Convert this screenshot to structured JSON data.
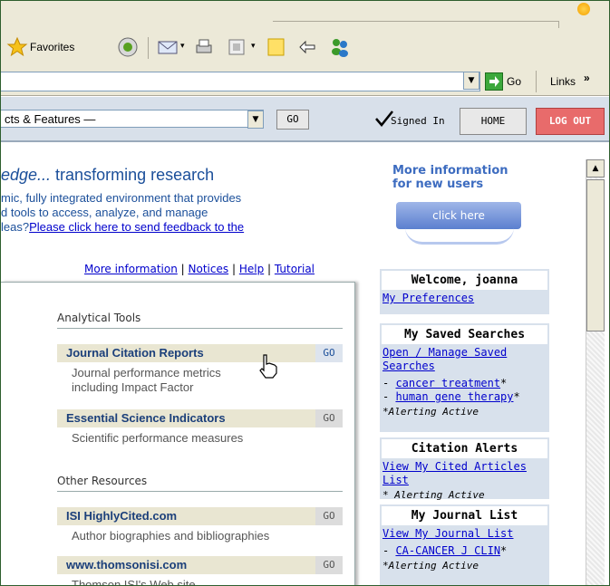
{
  "browser": {
    "toolbar": {
      "favorites_label": "Favorites",
      "icons": [
        "favorites-star-icon",
        "media-icon",
        "mail-icon",
        "print-icon",
        "edit-icon",
        "discuss-icon",
        "research-icon",
        "messenger-icon"
      ]
    },
    "address": {
      "go_label": "Go",
      "links_label": "Links",
      "links_chevron": "»"
    }
  },
  "app_header": {
    "product_select_value": "cts & Features —",
    "go_label": "GO",
    "signed_in_label": "Signed In",
    "home_label": "HOME",
    "logout_label": "LOG OUT"
  },
  "main": {
    "tagline_prefix": "edge...",
    "tagline_rest": " transforming research",
    "intro_lines": [
      "mic, fully integrated environment that provides",
      "d tools to access, analyze, and manage",
      "leas?"
    ],
    "feedback_link": "Please click here to send feedback to the",
    "links": {
      "more_info": "More information",
      "notices": "Notices",
      "help": "Help",
      "tutorial": "Tutorial",
      "sep": "|"
    },
    "analytical_tools_heading": "Analytical Tools",
    "other_resources_heading": "Other Resources",
    "products": [
      {
        "name": "Journal Citation Reports",
        "go": "GO",
        "desc": "Journal performance metrics including Impact Factor"
      },
      {
        "name": "Essential Science Indicators",
        "go": "GO",
        "desc": "Scientific performance measures"
      },
      {
        "name": "ISI HighlyCited.com",
        "go": "GO",
        "desc": "Author biographies and bibliographies"
      },
      {
        "name": "www.thomsonisi.com",
        "go": "GO",
        "desc": "Thomson ISI's Web site"
      }
    ]
  },
  "sidebar": {
    "more_info_line1": "More information",
    "more_info_line2": "for new users",
    "click_here": "click here",
    "welcome_title": "Welcome, joanna",
    "my_preferences": "My Preferences",
    "saved_searches_title": "My Saved Searches",
    "open_manage_saved_1": "Open / Manage Saved",
    "open_manage_saved_2": "Searches",
    "saved_items": [
      "cancer treatment",
      "human gene therapy"
    ],
    "alert_star": "*",
    "item_prefix": "- ",
    "alerting_active": "*Alerting Active",
    "citation_alerts_title": "Citation Alerts",
    "view_cited_articles": "View My Cited Articles List",
    "alerting_active_spaced": "* Alerting Active",
    "journal_list_title": "My Journal List",
    "view_journal_list": "View My Journal List",
    "journal_items": [
      "CA-CANCER J CLIN"
    ]
  },
  "colors": {
    "accent_blue": "#1b4f9a",
    "link_blue": "#0000cc",
    "logout_red": "#e86b6b",
    "header_bg": "#d8e0ea",
    "product_bar": "#e9e6d2"
  }
}
